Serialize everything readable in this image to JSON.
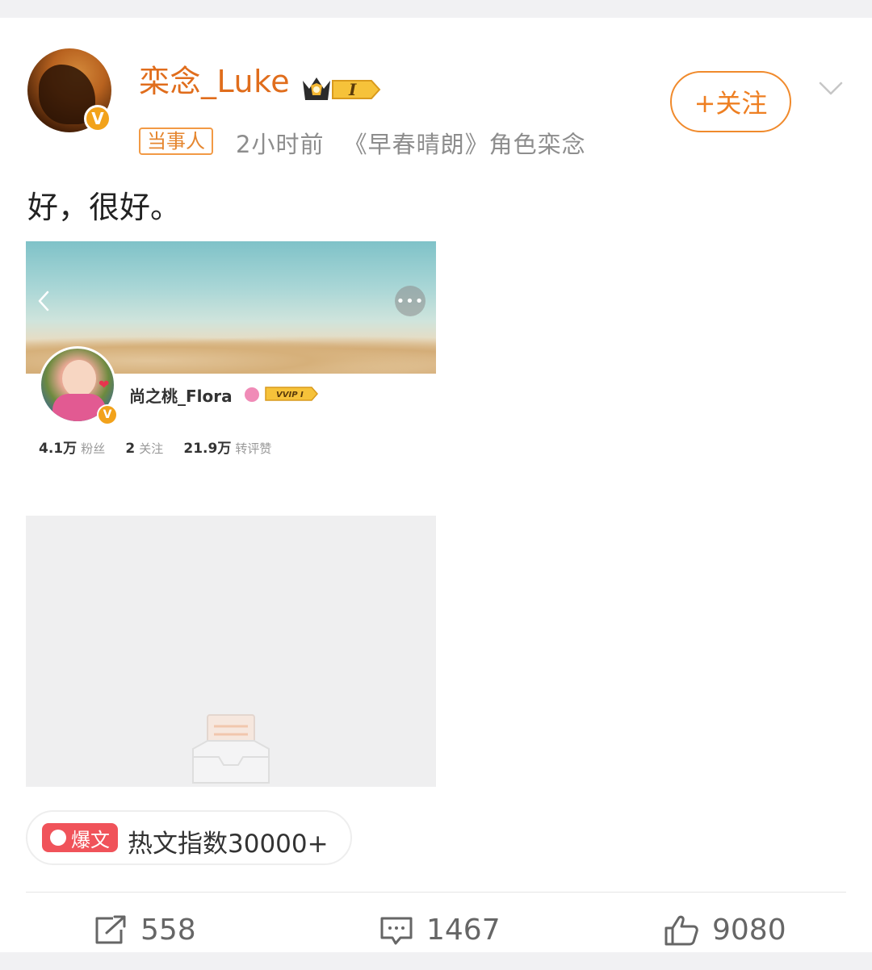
{
  "post": {
    "author": {
      "name": "栾念_Luke",
      "level_badge": "I",
      "tag": "当事人",
      "time": "2小时前",
      "source": "《早春晴朗》角色栾念"
    },
    "follow_label": "+关注",
    "text": "好，很好。",
    "embedded_screenshot": {
      "profile_name": "尚之桃_Flora",
      "vip_label": "VVIP I",
      "stats": [
        {
          "value": "4.1万",
          "label": "粉丝"
        },
        {
          "value": "2",
          "label": "关注"
        },
        {
          "value": "21.9万",
          "label": "转评赞"
        }
      ]
    },
    "hot_badge": {
      "label": "爆文",
      "text": "热文指数30000+"
    },
    "actions": {
      "repost_count": "558",
      "comment_count": "1467",
      "like_count": "9080"
    }
  },
  "colors": {
    "accent": "#ee7f22",
    "hot_red": "#f0535a",
    "verified": "#f2a21b"
  },
  "icons": [
    "verified-icon",
    "crown-icon",
    "chevron-down-icon",
    "back-arrow-icon",
    "more-icon",
    "repost-icon",
    "comment-icon",
    "like-icon"
  ]
}
